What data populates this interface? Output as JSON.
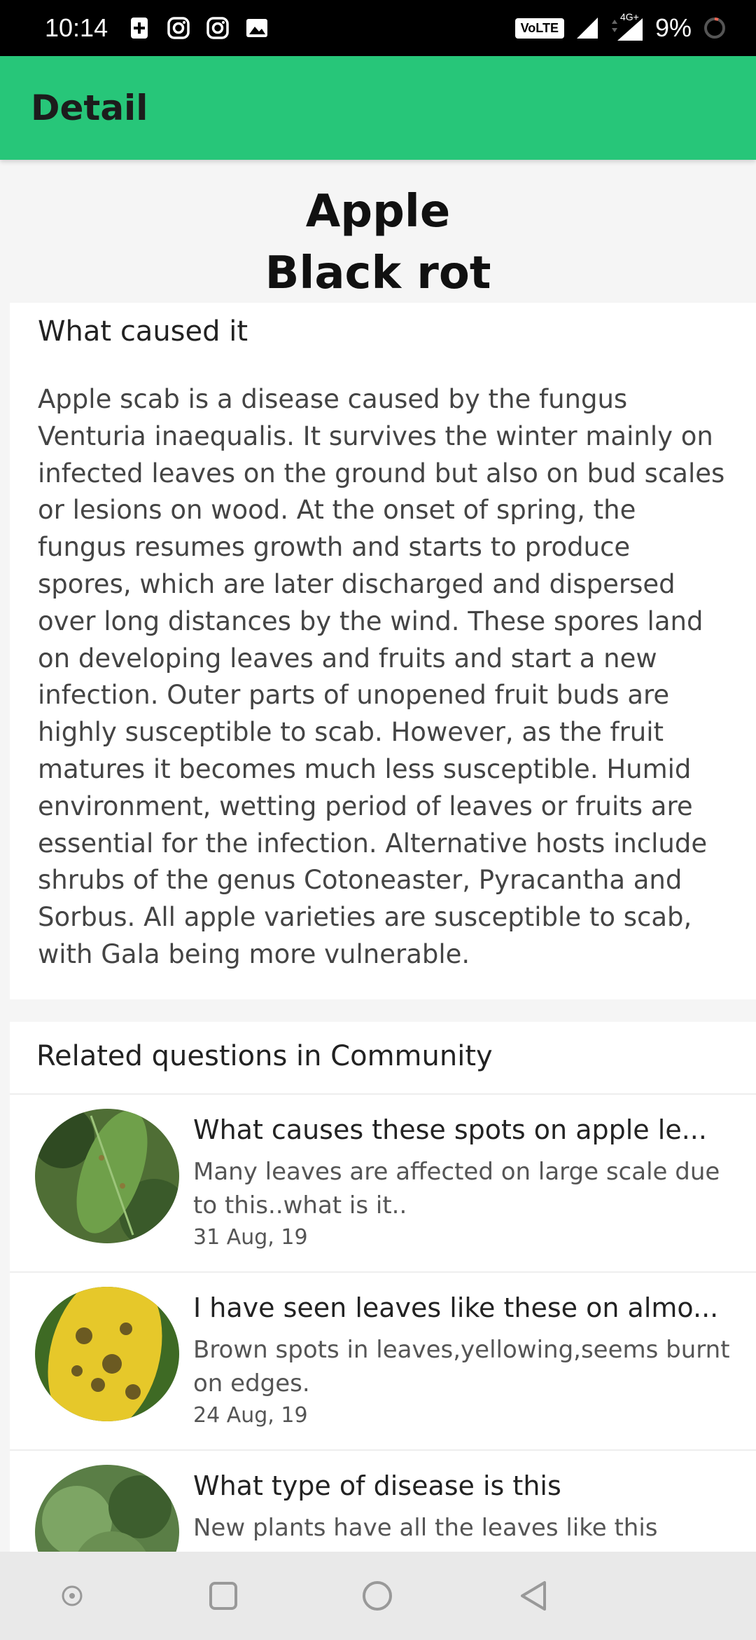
{
  "status_bar": {
    "time": "10:14",
    "volte": "VoLTE",
    "network": "4G+",
    "battery": "9%"
  },
  "app_bar": {
    "title": "Detail"
  },
  "crop": {
    "name": "Apple",
    "disease": "Black rot"
  },
  "cause": {
    "heading": "What caused it",
    "text": "Apple scab is a disease caused by the fungus Venturia inaequalis. It survives the winter mainly on infected leaves on the ground but also on bud scales or lesions on wood. At the onset of spring, the fungus resumes growth and starts to produce spores, which are later discharged and dispersed over long distances by the wind. These spores land on developing leaves and fruits and start a new infection. Outer parts of unopened fruit buds are highly susceptible to scab. However, as the fruit matures it becomes much less susceptible. Humid environment, wetting period of leaves or fruits are essential for the infection. Alternative hosts include shrubs of the genus Cotoneaster, Pyracantha and Sorbus. All apple varieties are susceptible to scab, with Gala being more vulnerable."
  },
  "community": {
    "heading": "Related questions in Community",
    "questions": [
      {
        "title": "What causes these spots on apple le...",
        "desc": "Many leaves are affected on large scale due to this..what is it..",
        "date": "31 Aug, 19"
      },
      {
        "title": "I have seen leaves like these on almo...",
        "desc": "Brown spots in leaves,yellowing,seems burnt on edges.",
        "date": "24 Aug, 19"
      },
      {
        "title": "What type of disease is this",
        "desc": "New plants have all the leaves like this",
        "date": ""
      }
    ]
  },
  "colors": {
    "accent": "#27c679",
    "status_bar": "#000000",
    "nav_bar": "#e9e9e9"
  },
  "icons": [
    "plus-icon",
    "instagram-icon",
    "instagram-icon",
    "image-icon",
    "signal-icon",
    "battery-icon",
    "nav-dot-icon",
    "nav-recents-icon",
    "nav-home-icon",
    "nav-back-icon"
  ]
}
